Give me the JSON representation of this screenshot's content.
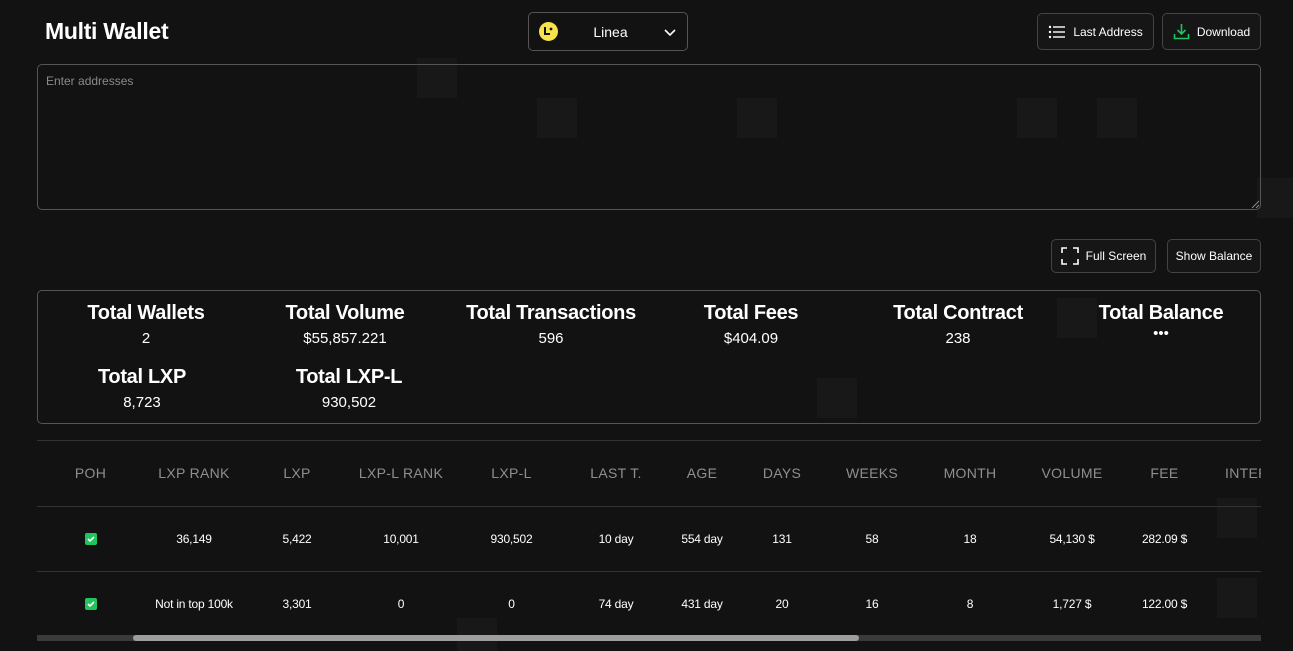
{
  "page_title": "Multi Wallet",
  "network": {
    "label": "Linea",
    "logo": "linea-logo-icon",
    "logo_color": "#f7e34a"
  },
  "header_buttons": {
    "last_address": "Last Address",
    "download": "Download"
  },
  "addresses": {
    "placeholder": "Enter addresses",
    "value": ""
  },
  "toolbar": {
    "full_screen": "Full Screen",
    "show_balance": "Show Balance"
  },
  "stats": {
    "total_wallets": {
      "label": "Total Wallets",
      "value": "2"
    },
    "total_volume": {
      "label": "Total Volume",
      "value": "$55,857.221"
    },
    "total_transactions": {
      "label": "Total Transactions",
      "value": "596"
    },
    "total_fees": {
      "label": "Total Fees",
      "value": "$404.09"
    },
    "total_contract": {
      "label": "Total Contract",
      "value": "238"
    },
    "total_balance": {
      "label": "Total Balance",
      "value": "•••"
    },
    "total_lxp": {
      "label": "Total LXP",
      "value": "8,723"
    },
    "total_lxp_l": {
      "label": "Total LXP-L",
      "value": "930,502"
    }
  },
  "table": {
    "columns": [
      "POH",
      "LXP RANK",
      "LXP",
      "LXP-L RANK",
      "LXP-L",
      "LAST T.",
      "AGE",
      "DAYS",
      "WEEKS",
      "MONTH",
      "VOLUME",
      "FEE",
      "INTER"
    ],
    "rows": [
      {
        "poh": true,
        "lxp_rank": "36,149",
        "lxp": "5,422",
        "lxp_l_rank": "10,001",
        "lxp_l": "930,502",
        "last_t": "10 day",
        "age": "554 day",
        "days": "131",
        "weeks": "58",
        "month": "18",
        "volume": "54,130 $",
        "fee": "282.09 $",
        "inter": ""
      },
      {
        "poh": true,
        "lxp_rank": "Not in top 100k",
        "lxp": "3,301",
        "lxp_l_rank": "0",
        "lxp_l": "0",
        "last_t": "74 day",
        "age": "431 day",
        "days": "20",
        "weeks": "16",
        "month": "8",
        "volume": "1,727 $",
        "fee": "122.00 $",
        "inter": ""
      }
    ]
  },
  "colors": {
    "background": "#121212",
    "border": "#555555",
    "check": "#21c45d",
    "download_icon": "#21c45d"
  }
}
